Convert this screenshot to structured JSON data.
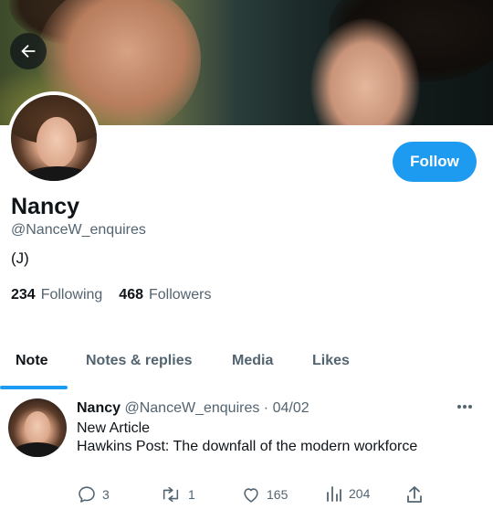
{
  "profile": {
    "name": "Nancy",
    "handle": "@NanceW_enquires",
    "bio": "(J)",
    "follow_label": "Follow",
    "following_count": "234",
    "following_label": "Following",
    "followers_count": "468",
    "followers_label": "Followers"
  },
  "tabs": [
    {
      "label": "Note",
      "active": true
    },
    {
      "label": "Notes & replies",
      "active": false
    },
    {
      "label": "Media",
      "active": false
    },
    {
      "label": "Likes",
      "active": false
    }
  ],
  "tweet": {
    "name": "Nancy",
    "meta": "@NanceW_enquires · 04/02",
    "line1": "New Article",
    "line2": "Hawkins Post: The downfall of the modern workforce",
    "replies": "3",
    "retweets": "1",
    "likes": "165",
    "views": "204"
  },
  "colors": {
    "accent": "#1d9bf0",
    "text_primary": "#0f1419",
    "text_secondary": "#536471"
  },
  "icons": [
    "back-arrow-icon",
    "more-icon",
    "reply-icon",
    "retweet-icon",
    "like-icon",
    "views-icon",
    "share-icon"
  ]
}
